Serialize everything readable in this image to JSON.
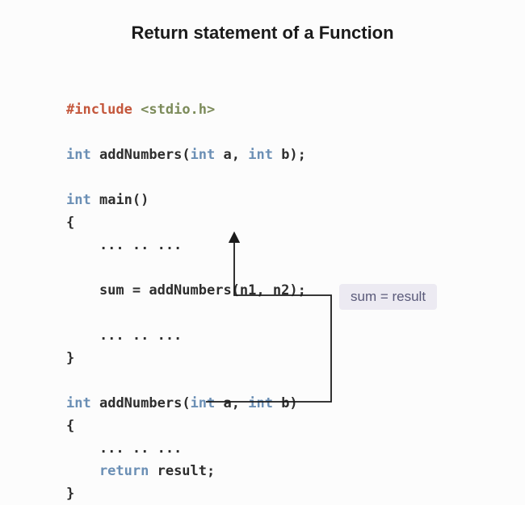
{
  "title": "Return statement of a Function",
  "code": {
    "l01_include": "#include",
    "l01_header": "<stdio.h>",
    "l02_type1": "int",
    "l02_fn": "addNumbers(",
    "l02_type2": "int",
    "l02_p1": " a, ",
    "l02_type3": "int",
    "l02_p2": " b);",
    "l03_type1": "int",
    "l03_fn": "main()",
    "l04_brace_open": "{",
    "l05_dots": "    ... .. ...",
    "l06_blank": "",
    "l07_call": "    sum = addNumbers(n1, n2);",
    "l08_blank": "",
    "l09_dots": "    ... .. ...",
    "l10_brace_close": "}",
    "l11_blank": "",
    "l12_type1": "int",
    "l12_fn": "addNumbers(",
    "l12_type2": "int",
    "l12_p1": " a, ",
    "l12_type3": "int",
    "l12_p2": " b)",
    "l13_brace_open": "{",
    "l14_dots": "    ... .. ...",
    "l15_kw": "    return",
    "l15_expr": " result;",
    "l16_brace_close": "}"
  },
  "annotation": "sum = result"
}
